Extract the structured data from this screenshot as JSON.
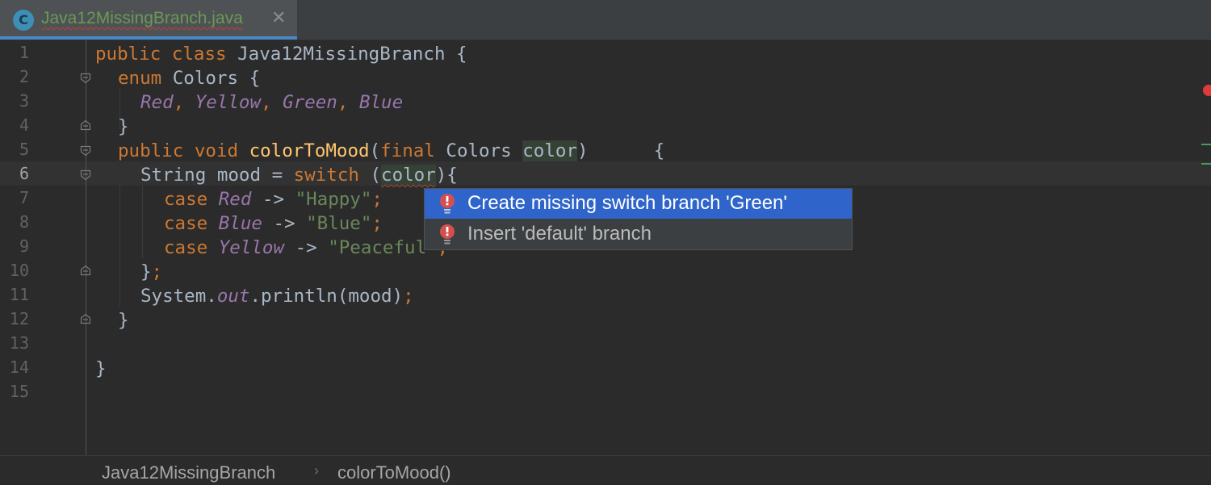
{
  "tab": {
    "title": "Java12MissingBranch.java",
    "icon_letter": "C",
    "close_glyph": "✕"
  },
  "editor": {
    "line_numbers": [
      "1",
      "2",
      "3",
      "4",
      "5",
      "6",
      "7",
      "8",
      "9",
      "10",
      "11",
      "12",
      "13",
      "14",
      "15"
    ],
    "current_line": "6",
    "code": {
      "l1": {
        "kw1": "public",
        "kw2": "class",
        "name": "Java12MissingBranch",
        "brace": "{"
      },
      "l2": {
        "kw": "enum",
        "name": "Colors",
        "brace": "{"
      },
      "l3": {
        "c1": "Red",
        "c2": "Yellow",
        "c3": "Green",
        "c4": "Blue",
        "sep": ","
      },
      "l4": {
        "brace": "}"
      },
      "l5": {
        "kw1": "public",
        "kw2": "void",
        "fn": "colorToMood",
        "open": "(",
        "kw3": "final",
        "type": "Colors",
        "param": "color",
        "close": ")",
        "brace": "{"
      },
      "l6": {
        "type": "String",
        "var": "mood",
        "eq": "=",
        "kw": "switch",
        "open": "(",
        "arg": "color",
        "close": "){"
      },
      "l7": {
        "kw": "case",
        "en": "Red",
        "arrow": "->",
        "str": "\"Happy\"",
        "semi": ";"
      },
      "l8": {
        "kw": "case",
        "en": "Blue",
        "arrow": "->",
        "str": "\"Blue\"",
        "semi": ";"
      },
      "l9": {
        "kw": "case",
        "en": "Yellow",
        "arrow": "->",
        "str": "\"Peaceful\"",
        "semi": ";"
      },
      "l10": {
        "brace": "}",
        "semi": ";"
      },
      "l11": {
        "obj": "System.",
        "field": "out",
        "call": ".println(mood)",
        "semi": ";"
      },
      "l12": {
        "brace": "}"
      },
      "l14": {
        "brace": "}"
      }
    }
  },
  "popup": {
    "items": [
      {
        "label": "Create missing switch branch 'Green'",
        "selected": true,
        "icon": "error-bulb-icon"
      },
      {
        "label": "Insert 'default' branch",
        "selected": false,
        "icon": "error-bulb-icon"
      }
    ]
  },
  "breadcrumb": {
    "items": [
      "Java12MissingBranch",
      "colorToMood()"
    ],
    "separator": "›"
  },
  "colors": {
    "keyword": "#cc7832",
    "enum_const": "#9876aa",
    "string": "#6a8759",
    "function": "#ffc66d",
    "selection": "#2f65ca"
  }
}
